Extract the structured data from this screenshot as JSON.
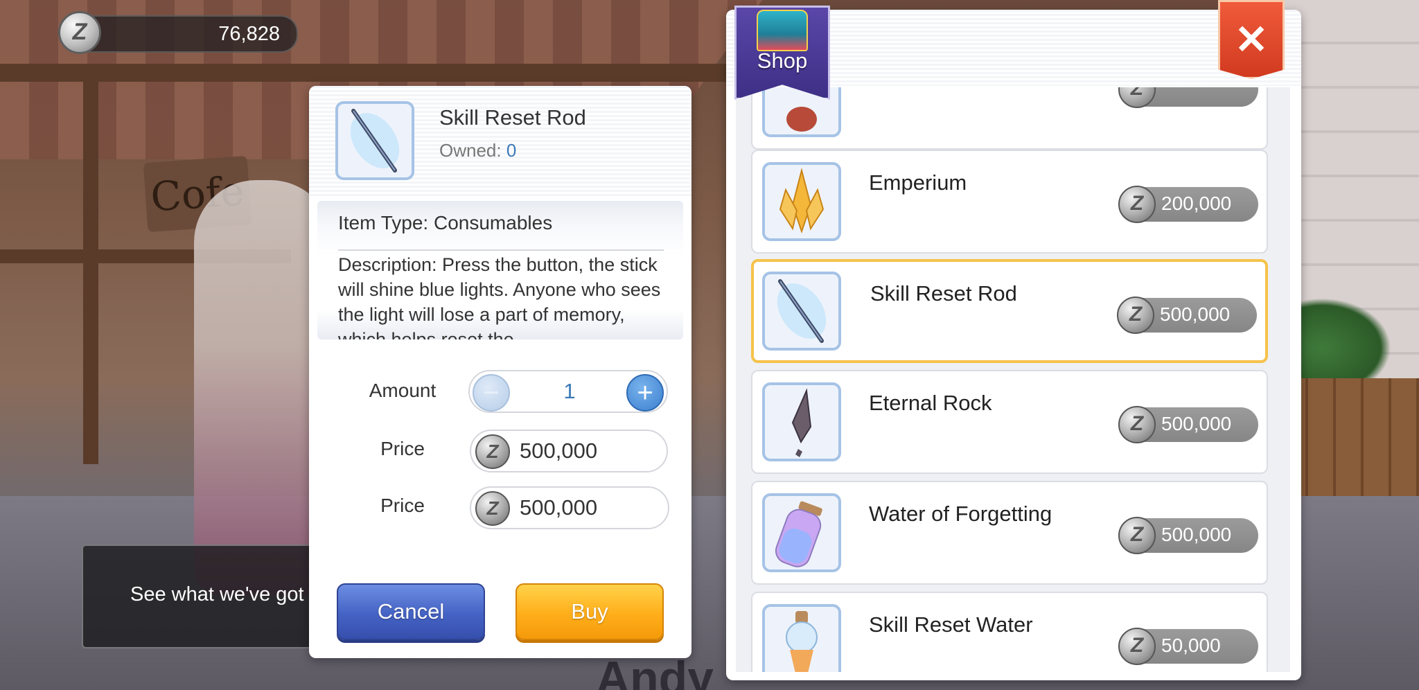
{
  "currency": {
    "zeny": "76,828",
    "coin_symbol": "Z"
  },
  "npc": {
    "dialogue": "See what we've got"
  },
  "scene": {
    "cafe_sign": "Cofe",
    "name_tag": "Andy"
  },
  "detail": {
    "item_name": "Skill Reset Rod",
    "owned_label": "Owned:",
    "owned_count": "0",
    "item_type": "Item Type: Consumables",
    "description": "Description: Press the button, the stick will shine blue lights. Anyone who sees the light will lose a part of memory, which helps reset the",
    "amount_label": "Amount",
    "amount_value": "1",
    "minus_symbol": "−",
    "plus_symbol": "+",
    "price_label_1": "Price",
    "price_value_1": "500,000",
    "price_label_2": "Price",
    "price_value_2": "500,000",
    "cancel_label": "Cancel",
    "buy_label": "Buy"
  },
  "shop": {
    "title": "Shop",
    "close_symbol": "✕",
    "items": [
      {
        "name": "",
        "price": "",
        "icon": "potion-icon"
      },
      {
        "name": "Emperium",
        "price": "200,000",
        "icon": "emperium-icon"
      },
      {
        "name": "Skill Reset Rod",
        "price": "500,000",
        "icon": "rod-icon",
        "selected": true
      },
      {
        "name": "Eternal Rock",
        "price": "500,000",
        "icon": "rock-icon"
      },
      {
        "name": "Water of Forgetting",
        "price": "500,000",
        "icon": "bottle-icon"
      },
      {
        "name": "Skill Reset Water",
        "price": "50,000",
        "icon": "flask-icon"
      }
    ]
  },
  "colors": {
    "selected_border": "#f5c24a",
    "cancel_blue": "#4563c4",
    "buy_orange": "#ffae1a",
    "owned_blue": "#3b7ab8"
  }
}
